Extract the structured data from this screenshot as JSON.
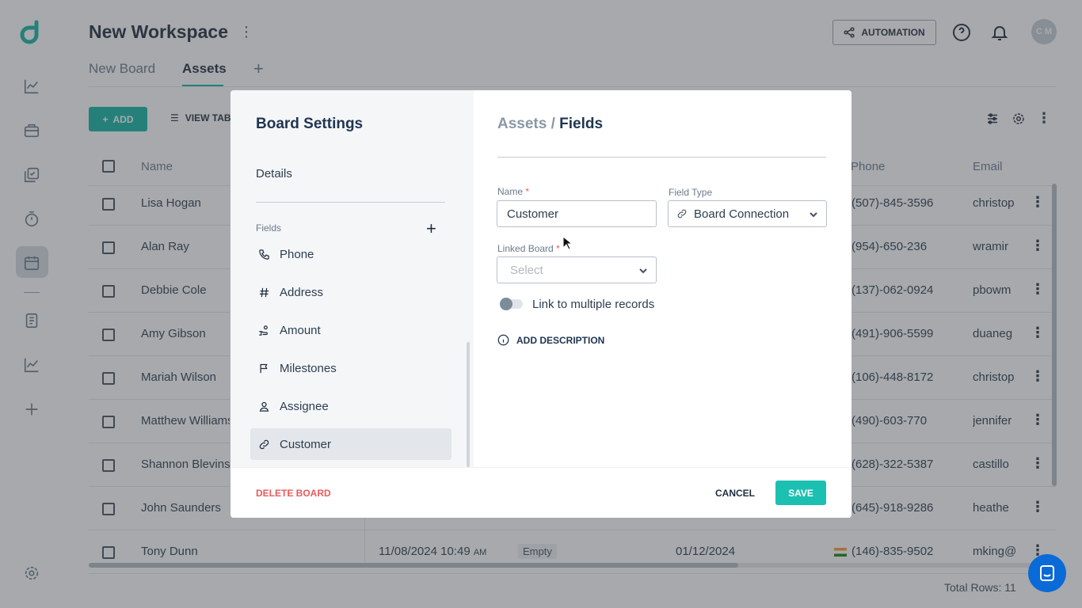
{
  "workspace": {
    "title": "New Workspace",
    "menu_glyph": "⋮"
  },
  "tabs": [
    {
      "label": "New Board"
    },
    {
      "label": "Assets"
    }
  ],
  "tab_add_glyph": "+",
  "header": {
    "automation_label": "AUTOMATION",
    "avatar_initials": "C M"
  },
  "toolbar": {
    "add_label": "ADD",
    "view_label": "VIEW TAB"
  },
  "grid": {
    "columns": {
      "name": "Name",
      "phone": "Phone",
      "email": "Email"
    },
    "rows": [
      {
        "name": "Lisa Hogan",
        "phone": "(507)-845-3596",
        "email": "christop"
      },
      {
        "name": "Alan Ray",
        "phone": "(954)-650-236",
        "email": "wramir"
      },
      {
        "name": "Debbie Cole",
        "phone": "(137)-062-0924",
        "email": "pbowm"
      },
      {
        "name": "Amy Gibson",
        "phone": "(491)-906-5599",
        "email": "duaneg"
      },
      {
        "name": "Mariah Wilson",
        "phone": "(106)-448-8172",
        "email": "christop"
      },
      {
        "name": "Matthew Williams",
        "phone": "(490)-603-770",
        "email": "jennifer"
      },
      {
        "name": "Shannon Blevins",
        "phone": "(628)-322-5387",
        "email": "castillo"
      },
      {
        "name": "John Saunders",
        "phone": "(645)-918-9286",
        "email": "heathe"
      },
      {
        "name": "Tony Dunn",
        "created": "11/08/2024 10:49",
        "created_suffix": "AM",
        "status": "Empty",
        "date": "01/12/2024",
        "phone": "(146)-835-9502",
        "email": "mking@"
      }
    ],
    "total_rows": "Total Rows: 11"
  },
  "modal": {
    "title": "Board Settings",
    "details_label": "Details",
    "fields_label": "Fields",
    "add_glyph": "+",
    "fields": [
      {
        "label": "Phone",
        "icon": "phone-icon"
      },
      {
        "label": "Address",
        "icon": "hash-icon"
      },
      {
        "label": "Amount",
        "icon": "money-hand-icon"
      },
      {
        "label": "Milestones",
        "icon": "flag-icon"
      },
      {
        "label": "Assignee",
        "icon": "user-icon"
      },
      {
        "label": "Customer",
        "icon": "link-icon",
        "active": true
      }
    ],
    "breadcrumb": {
      "parent": "Assets",
      "separator": "/",
      "current": "Fields"
    },
    "form": {
      "name_label": "Name",
      "required_mark": "*",
      "name_value": "Customer",
      "field_type_label": "Field Type",
      "field_type_value": "Board Connection",
      "linked_board_label": "Linked Board",
      "linked_board_placeholder": "Select",
      "toggle_label": "Link to multiple records",
      "toggle_on": false,
      "add_description_label": "ADD DESCRIPTION"
    },
    "footer": {
      "delete_label": "DELETE BOARD",
      "cancel_label": "CANCEL",
      "save_label": "SAVE"
    }
  },
  "colors": {
    "accent": "#15b5a4",
    "danger": "#e85b5b",
    "chat": "#0a6ad8"
  }
}
